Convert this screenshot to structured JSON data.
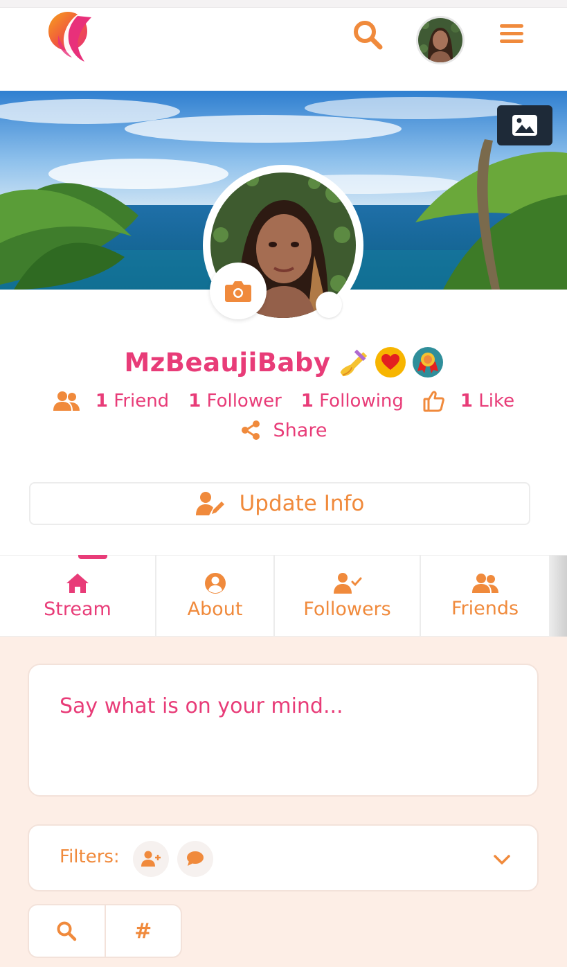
{
  "header": {
    "logo_icon": "goddess-logo-icon",
    "search_icon": "search-icon",
    "menu_icon": "hamburger-menu-icon"
  },
  "profile": {
    "username": "MzBeaujiBaby",
    "badges": [
      "nail-polish-emoji",
      "heart-badge-icon",
      "award-ribbon-badge-icon"
    ],
    "stats": {
      "friends_count": "1",
      "friends_label": "Friend",
      "followers_count": "1",
      "followers_label": "Follower",
      "following_count": "1",
      "following_label": "Following",
      "likes_count": "1",
      "likes_label": "Like"
    },
    "share_label": "Share",
    "update_label": "Update Info"
  },
  "tabs": [
    {
      "label": "Stream",
      "icon": "home-icon",
      "active": true
    },
    {
      "label": "About",
      "icon": "user-circle-icon",
      "active": false
    },
    {
      "label": "Followers",
      "icon": "user-check-icon",
      "active": false
    },
    {
      "label": "Friends",
      "icon": "users-icon",
      "active": false
    }
  ],
  "composer": {
    "placeholder": "Say what is on your mind..."
  },
  "filters": {
    "label": "Filters:"
  },
  "search_tags": {
    "search_icon": "search-icon",
    "hashtag": "#"
  },
  "colors": {
    "primary_pink": "#e83c78",
    "accent_orange": "#f08a3c",
    "feed_background": "#fdeee6"
  }
}
